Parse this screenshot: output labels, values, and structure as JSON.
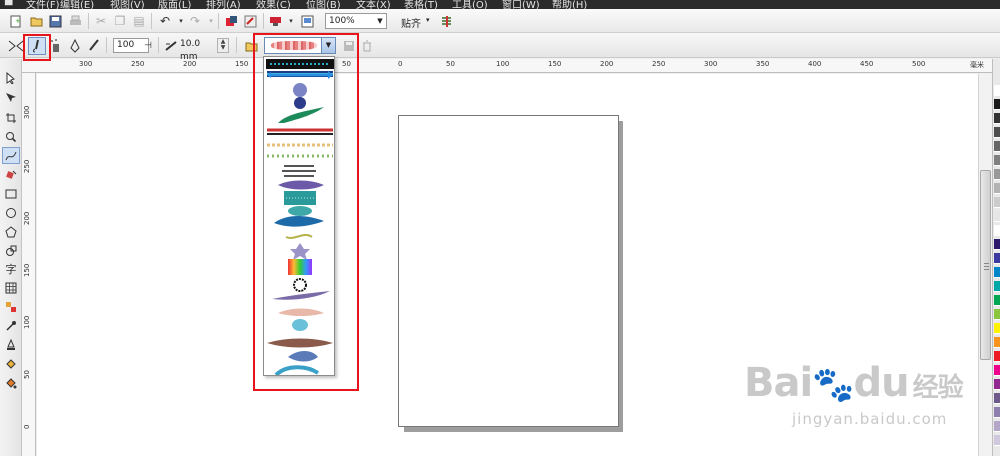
{
  "menubar": {
    "items": [
      "文件(F)",
      "编辑(E)",
      "视图(V)",
      "版面(L)",
      "排列(A)",
      "效果(C)",
      "位图(B)",
      "文本(X)",
      "表格(T)",
      "工具(O)",
      "窗口(W)",
      "帮助(H)"
    ]
  },
  "toolbar": {
    "zoom_value": "100%",
    "snap_label": "贴齐"
  },
  "property_bar": {
    "smoothing_value": "100",
    "width_value": "10.0 mm"
  },
  "ruler": {
    "h_labels": [
      "300",
      "250",
      "200",
      "150",
      "100",
      "50",
      "0",
      "50",
      "100",
      "150",
      "200",
      "250",
      "300",
      "350",
      "400",
      "450",
      "500"
    ],
    "h_unit": "毫米",
    "v_labels": [
      "300",
      "250",
      "200",
      "150",
      "100",
      "50",
      "0"
    ]
  },
  "palette": {
    "colors": [
      "#ffffff",
      "#1a1a1a",
      "#333333",
      "#4d4d4d",
      "#666666",
      "#808080",
      "#999999",
      "#b3b3b3",
      "#cccccc",
      "#e6e6e6",
      "#ffffff",
      "#2e1a6b",
      "#3a3aa0",
      "#0086c8",
      "#00a8a8",
      "#00a651",
      "#8cc63f",
      "#fff200",
      "#f7941d",
      "#ed1c24",
      "#ec008c",
      "#92278f",
      "#6d5a8a",
      "#8f7fae",
      "#b3a6c9",
      "#d0c8de"
    ]
  },
  "watermark": {
    "brand": "Bai",
    "brand2": "du",
    "suffix": "经验",
    "url": "jingyan.baidu.com"
  }
}
